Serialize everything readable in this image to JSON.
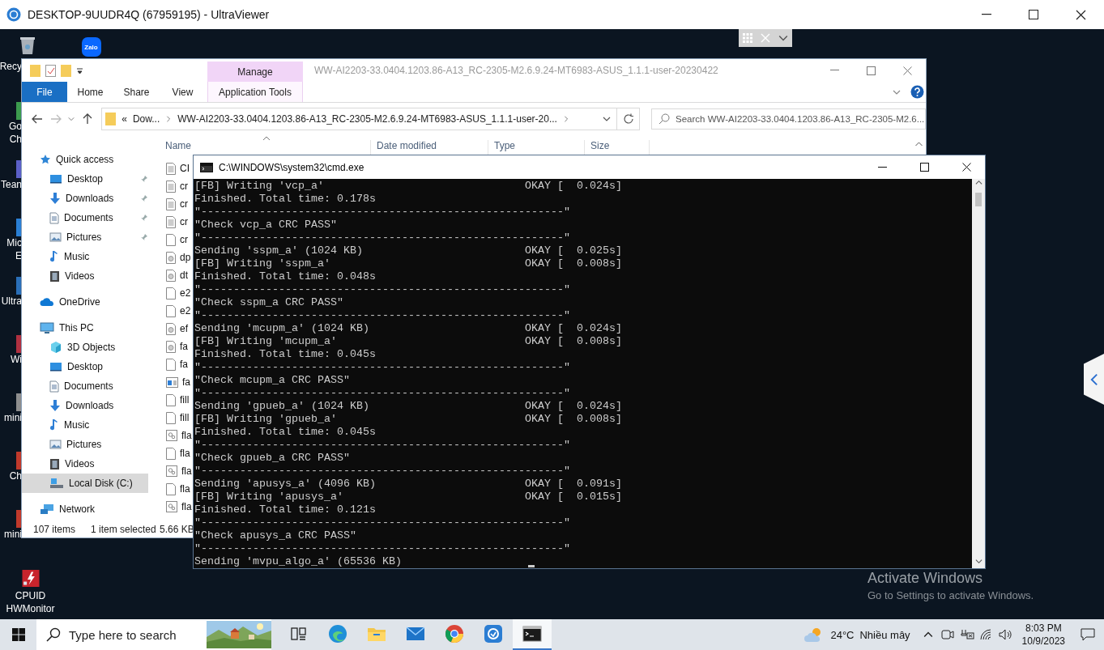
{
  "viewer_window": {
    "title": "DESKTOP-9UUDR4Q (67959195) - UltraViewer"
  },
  "desktop_icons": [
    {
      "kind": "recycle-bin",
      "label": [
        "Recy"
      ]
    },
    {
      "kind": "stub",
      "color": "#3c9b4e",
      "label": [
        "Go",
        "Ch"
      ]
    },
    {
      "kind": "stub",
      "color": "#5b5fc7",
      "label": [
        "Tean"
      ]
    },
    {
      "kind": "stub",
      "color": "#2a7fd4",
      "label": [
        "Mic",
        "E"
      ]
    },
    {
      "kind": "stub",
      "color": "#2a6fb8",
      "label": [
        "Ultra"
      ]
    },
    {
      "kind": "stub",
      "color": "#b03040",
      "label": [
        "Wi"
      ]
    },
    {
      "kind": "stub",
      "color": "#8e8e8e",
      "label": [
        "mini"
      ]
    },
    {
      "kind": "stub",
      "color": "#c0392b",
      "label": [
        "Ch"
      ]
    },
    {
      "kind": "stub",
      "color": "#c0392b",
      "label": [
        "mini"
      ]
    },
    {
      "kind": "hwmonitor",
      "label": [
        "CPUID",
        "HWMonitor"
      ]
    },
    {
      "kind": "zalo",
      "logo": "Zalo"
    }
  ],
  "explorer": {
    "title": "WW-AI2203-33.0404.1203.86-A13_RC-2305-M2.6.9.24-MT6983-ASUS_1.1.1-user-20230422",
    "context_tab": "Manage",
    "ribbon_tabs": [
      {
        "label": "File",
        "kind": "file",
        "selected": false
      },
      {
        "label": "Home",
        "kind": "tab",
        "selected": false
      },
      {
        "label": "Share",
        "kind": "tab",
        "selected": false
      },
      {
        "label": "View",
        "kind": "tab",
        "selected": false
      },
      {
        "label": "Application Tools",
        "kind": "context",
        "selected": false
      }
    ],
    "address": {
      "overflow": "«",
      "parts": [
        "Dow...",
        "WW-AI2203-33.0404.1203.86-A13_RC-2305-M2.6.9.24-MT6983-ASUS_1.1.1-user-20..."
      ]
    },
    "search": {
      "placeholder": "Search WW-AI2203-33.0404.1203.86-A13_RC-2305-M2.6..."
    },
    "nav": [
      {
        "label": "Quick access",
        "kind": "star",
        "selected": false,
        "children": [
          {
            "label": "Desktop",
            "kind": "desktop",
            "pinned": true,
            "selected": false
          },
          {
            "label": "Downloads",
            "kind": "downloads",
            "pinned": true,
            "selected": false
          },
          {
            "label": "Documents",
            "kind": "documents",
            "pinned": true,
            "selected": false
          },
          {
            "label": "Pictures",
            "kind": "pictures",
            "pinned": true,
            "selected": false
          },
          {
            "label": "Music",
            "kind": "music",
            "pinned": false,
            "selected": false
          },
          {
            "label": "Videos",
            "kind": "videos",
            "pinned": false,
            "selected": false
          }
        ]
      },
      {
        "label": "OneDrive",
        "kind": "cloud",
        "selected": false
      },
      {
        "label": "This PC",
        "kind": "pc",
        "selected": false,
        "children": [
          {
            "label": "3D Objects",
            "kind": "cube",
            "pinned": false,
            "selected": false
          },
          {
            "label": "Desktop",
            "kind": "desktop",
            "pinned": false,
            "selected": false
          },
          {
            "label": "Documents",
            "kind": "documents",
            "pinned": false,
            "selected": false
          },
          {
            "label": "Downloads",
            "kind": "downloads",
            "pinned": false,
            "selected": false
          },
          {
            "label": "Music",
            "kind": "music",
            "pinned": false,
            "selected": false
          },
          {
            "label": "Pictures",
            "kind": "pictures",
            "pinned": false,
            "selected": false
          },
          {
            "label": "Videos",
            "kind": "videos",
            "pinned": false,
            "selected": false
          },
          {
            "label": "Local Disk (C:)",
            "kind": "disk",
            "pinned": false,
            "selected": true
          }
        ]
      },
      {
        "label": "Network",
        "kind": "network",
        "selected": false
      }
    ],
    "columns": [
      "Name",
      "Date modified",
      "Type",
      "Size"
    ],
    "files": [
      {
        "name": "CI",
        "kind": "text"
      },
      {
        "name": "cr",
        "kind": "text"
      },
      {
        "name": "cr",
        "kind": "text"
      },
      {
        "name": "cr",
        "kind": "text"
      },
      {
        "name": "cr",
        "kind": "blank"
      },
      {
        "name": "dp",
        "kind": "disc"
      },
      {
        "name": "dt",
        "kind": "disc"
      },
      {
        "name": "e2",
        "kind": "blank"
      },
      {
        "name": "e2",
        "kind": "blank"
      },
      {
        "name": "ef",
        "kind": "disc"
      },
      {
        "name": "fa",
        "kind": "disc"
      },
      {
        "name": "fa",
        "kind": "blank"
      },
      {
        "name": "fa",
        "kind": "app"
      },
      {
        "name": "fill",
        "kind": "blank"
      },
      {
        "name": "fill",
        "kind": "blank"
      },
      {
        "name": "fla",
        "kind": "script"
      },
      {
        "name": "fla",
        "kind": "blank"
      },
      {
        "name": "fla",
        "kind": "script"
      },
      {
        "name": "fla",
        "kind": "blank"
      },
      {
        "name": "fla",
        "kind": "script"
      }
    ],
    "status": {
      "count": "107 items",
      "selection": "1 item selected",
      "size": "5.66 KB"
    }
  },
  "console": {
    "title": "C:\\WINDOWS\\system32\\cmd.exe",
    "lines": [
      {
        "text": "[FB] Writing 'vcp_a'",
        "status": "OKAY [  0.024s]"
      },
      {
        "text": "Finished. Total time: 0.178s"
      },
      {
        "text": "\"--------------------------------------------------------\""
      },
      {
        "text": "\"Check vcp_a CRC PASS\""
      },
      {
        "text": "\"--------------------------------------------------------\""
      },
      {
        "text": "Sending 'sspm_a' (1024 KB)",
        "status": "OKAY [  0.025s]"
      },
      {
        "text": "[FB] Writing 'sspm_a'",
        "status": "OKAY [  0.008s]"
      },
      {
        "text": "Finished. Total time: 0.048s"
      },
      {
        "text": "\"--------------------------------------------------------\""
      },
      {
        "text": "\"Check sspm_a CRC PASS\""
      },
      {
        "text": "\"--------------------------------------------------------\""
      },
      {
        "text": "Sending 'mcupm_a' (1024 KB)",
        "status": "OKAY [  0.024s]"
      },
      {
        "text": "[FB] Writing 'mcupm_a'",
        "status": "OKAY [  0.008s]"
      },
      {
        "text": "Finished. Total time: 0.045s"
      },
      {
        "text": "\"--------------------------------------------------------\""
      },
      {
        "text": "\"Check mcupm_a CRC PASS\""
      },
      {
        "text": "\"--------------------------------------------------------\""
      },
      {
        "text": "Sending 'gpueb_a' (1024 KB)",
        "status": "OKAY [  0.024s]"
      },
      {
        "text": "[FB] Writing 'gpueb_a'",
        "status": "OKAY [  0.008s]"
      },
      {
        "text": "Finished. Total time: 0.045s"
      },
      {
        "text": "\"--------------------------------------------------------\""
      },
      {
        "text": "\"Check gpueb_a CRC PASS\""
      },
      {
        "text": "\"--------------------------------------------------------\""
      },
      {
        "text": "Sending 'apusys_a' (4096 KB)",
        "status": "OKAY [  0.091s]"
      },
      {
        "text": "[FB] Writing 'apusys_a'",
        "status": "OKAY [  0.015s]"
      },
      {
        "text": "Finished. Total time: 0.121s"
      },
      {
        "text": "\"--------------------------------------------------------\""
      },
      {
        "text": "\"Check apusys_a CRC PASS\""
      },
      {
        "text": "\"--------------------------------------------------------\""
      },
      {
        "text": "Sending 'mvpu_algo_a' (65536 KB)",
        "cursor": true
      }
    ]
  },
  "activation": {
    "title": "Activate Windows",
    "hint": "Go to Settings to activate Windows."
  },
  "taskbar": {
    "search": {
      "placeholder": "Type here to search"
    },
    "apps": [
      {
        "kind": "task-view",
        "active": false
      },
      {
        "kind": "edge",
        "active": false
      },
      {
        "kind": "folder",
        "active": false
      },
      {
        "kind": "mail",
        "active": false
      },
      {
        "kind": "chrome",
        "active": false
      },
      {
        "kind": "viewer",
        "active": false
      },
      {
        "kind": "terminal",
        "active": true
      }
    ],
    "weather": {
      "temperature": "24°C",
      "condition": "Nhiều mây"
    },
    "clock": {
      "time": "8:03 PM",
      "date": "10/9/2023"
    }
  }
}
